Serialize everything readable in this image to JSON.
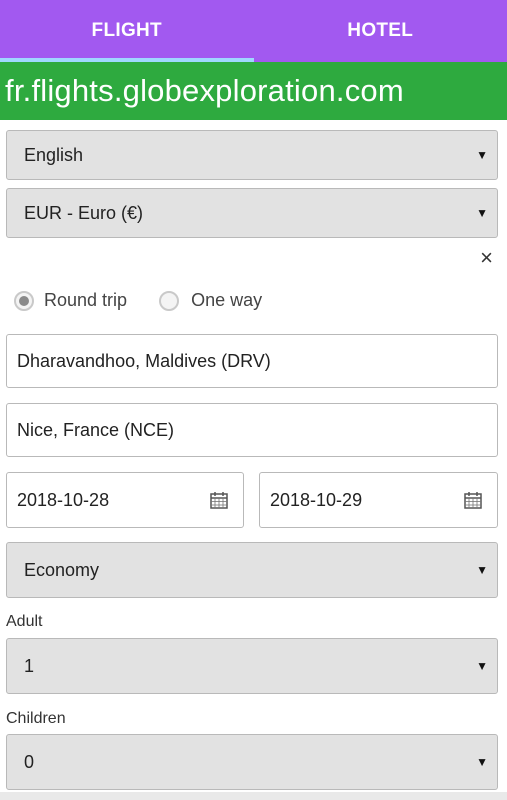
{
  "tabs": [
    {
      "label": "FLIGHT",
      "active": true
    },
    {
      "label": "HOTEL",
      "active": false
    }
  ],
  "domain": "fr.flights.globexploration.com",
  "language_select": {
    "value": "English"
  },
  "currency_select": {
    "value": "EUR - Euro (€)"
  },
  "close_label": "×",
  "trip_type": {
    "round_trip": "Round trip",
    "one_way": "One way",
    "selected": "round_trip"
  },
  "origin": {
    "value": "Dharavandhoo, Maldives (DRV)"
  },
  "destination": {
    "value": "Nice, France (NCE)"
  },
  "depart_date": {
    "value": "2018-10-28"
  },
  "return_date": {
    "value": "2018-10-29"
  },
  "cabin_select": {
    "value": "Economy"
  },
  "adult": {
    "label": "Adult",
    "value": "1"
  },
  "children": {
    "label": "Children",
    "value": "0"
  },
  "dropdown_arrow": "▼",
  "colors": {
    "tab_bar": "#a259f0",
    "domain_bar": "#2eaa3f",
    "active_tab_underline": "#9fd8ff"
  },
  "icons": {
    "calendar": "calendar-icon",
    "close": "close-icon",
    "dropdown": "chevron-down-icon"
  }
}
